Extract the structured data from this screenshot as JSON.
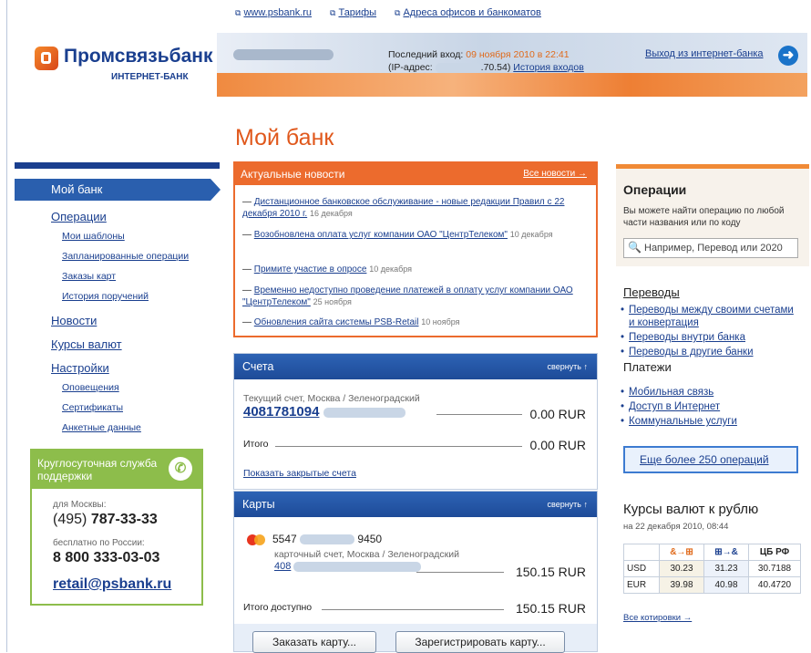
{
  "top_links": [
    "www.psbank.ru",
    "Тарифы",
    "Адреса офисов и банкоматов"
  ],
  "logo": {
    "name": "Промсвязьбанк",
    "sub": "ИНТЕРНЕТ-БАНК"
  },
  "header": {
    "last_login_label": "Последний вход:",
    "last_login_date": "09 ноября 2010 в 22:41",
    "ip_label": "(IP-адрес:",
    "ip_suffix": ".70.54)",
    "history_link": "История входов",
    "logout": "Выход из интернет-банка"
  },
  "page_title": "Мой банк",
  "sidebar": {
    "active": "Мой банк",
    "items": [
      {
        "label": "Операции",
        "sub": false
      },
      {
        "label": "Мои шаблоны",
        "sub": true
      },
      {
        "label": "Запланированные операции",
        "sub": true
      },
      {
        "label": "Заказы карт",
        "sub": true
      },
      {
        "label": "История поручений",
        "sub": true
      },
      {
        "label": "Новости",
        "sub": false
      },
      {
        "label": "Курсы валют",
        "sub": false
      },
      {
        "label": "Настройки",
        "sub": false
      },
      {
        "label": "Оповещения",
        "sub": true
      },
      {
        "label": "Сертификаты",
        "sub": true
      },
      {
        "label": "Анкетные данные",
        "sub": true
      }
    ]
  },
  "support": {
    "title": "Круглосуточная служба поддержки",
    "moscow_label": "для Москвы:",
    "moscow_code": "(495)",
    "moscow_num": "787-33-33",
    "russia_label": "бесплатно по России:",
    "russia_num": "8 800 333-03-03",
    "email": "retail@psbank.ru"
  },
  "news": {
    "title": "Актуальные новости",
    "all_link": "Все новости →",
    "items": [
      {
        "text": "Дистанционное банковское обслуживание - новые редакции Правил с 22 декабря 2010 г.",
        "date": "16 декабря"
      },
      {
        "text": "Возобновлена оплата услуг компании ОАО \"ЦентрТелеком\"",
        "date": "10 декабря"
      },
      {
        "text": "Примите участие в опросе",
        "date": "10 декабря"
      },
      {
        "text": "Временно недоступно проведение платежей в оплату услуг компании ОАО \"ЦентрТелеком\"",
        "date": "25 ноября"
      },
      {
        "text": "Обновления сайта системы PSB-Retail",
        "date": "10 ноября"
      }
    ]
  },
  "accounts": {
    "title": "Счета",
    "collapse": "свернуть ↑",
    "account_label": "Текущий счет, Москва / Зеленоградский",
    "account_number": "4081781094",
    "account_amount": "0.00 RUR",
    "total_label": "Итого",
    "total_amount": "0.00 RUR",
    "show_closed": "Показать закрытые счета"
  },
  "cards": {
    "title": "Карты",
    "collapse": "свернуть ↑",
    "card_prefix": "5547",
    "card_suffix": "9450",
    "card_account_label": "карточный счет, Москва / Зеленоградский",
    "card_account_num": "408",
    "card_amount": "150.15 RUR",
    "total_label": "Итого доступно",
    "total_amount": "150.15 RUR",
    "order_btn": "Заказать карту...",
    "register_btn": "Зарегистрировать карту..."
  },
  "operations": {
    "title": "Операции",
    "desc": "Вы можете найти операцию по любой части названия или по коду",
    "search_placeholder": "Например, Перевод или 2020",
    "transfers_title": "Переводы",
    "transfers": [
      "Переводы между своими счетами и конвертация",
      "Переводы внутри банка",
      "Переводы в другие банки"
    ],
    "payments_title": "Платежи",
    "payments": [
      "Мобильная связь",
      "Доступ в Интернет",
      "Коммунальные услуги"
    ],
    "more": "Еще более 250 операций"
  },
  "rates": {
    "title": "Курсы валют к рублю",
    "date": "на 22 декабря 2010, 08:44",
    "headers": [
      "",
      "&→⊞",
      "⊞→&",
      "ЦБ РФ"
    ],
    "rows": [
      [
        "USD",
        "30.23",
        "31.23",
        "30.7188"
      ],
      [
        "EUR",
        "39.98",
        "40.98",
        "40.4720"
      ]
    ],
    "all_link": "Все котировки →"
  }
}
